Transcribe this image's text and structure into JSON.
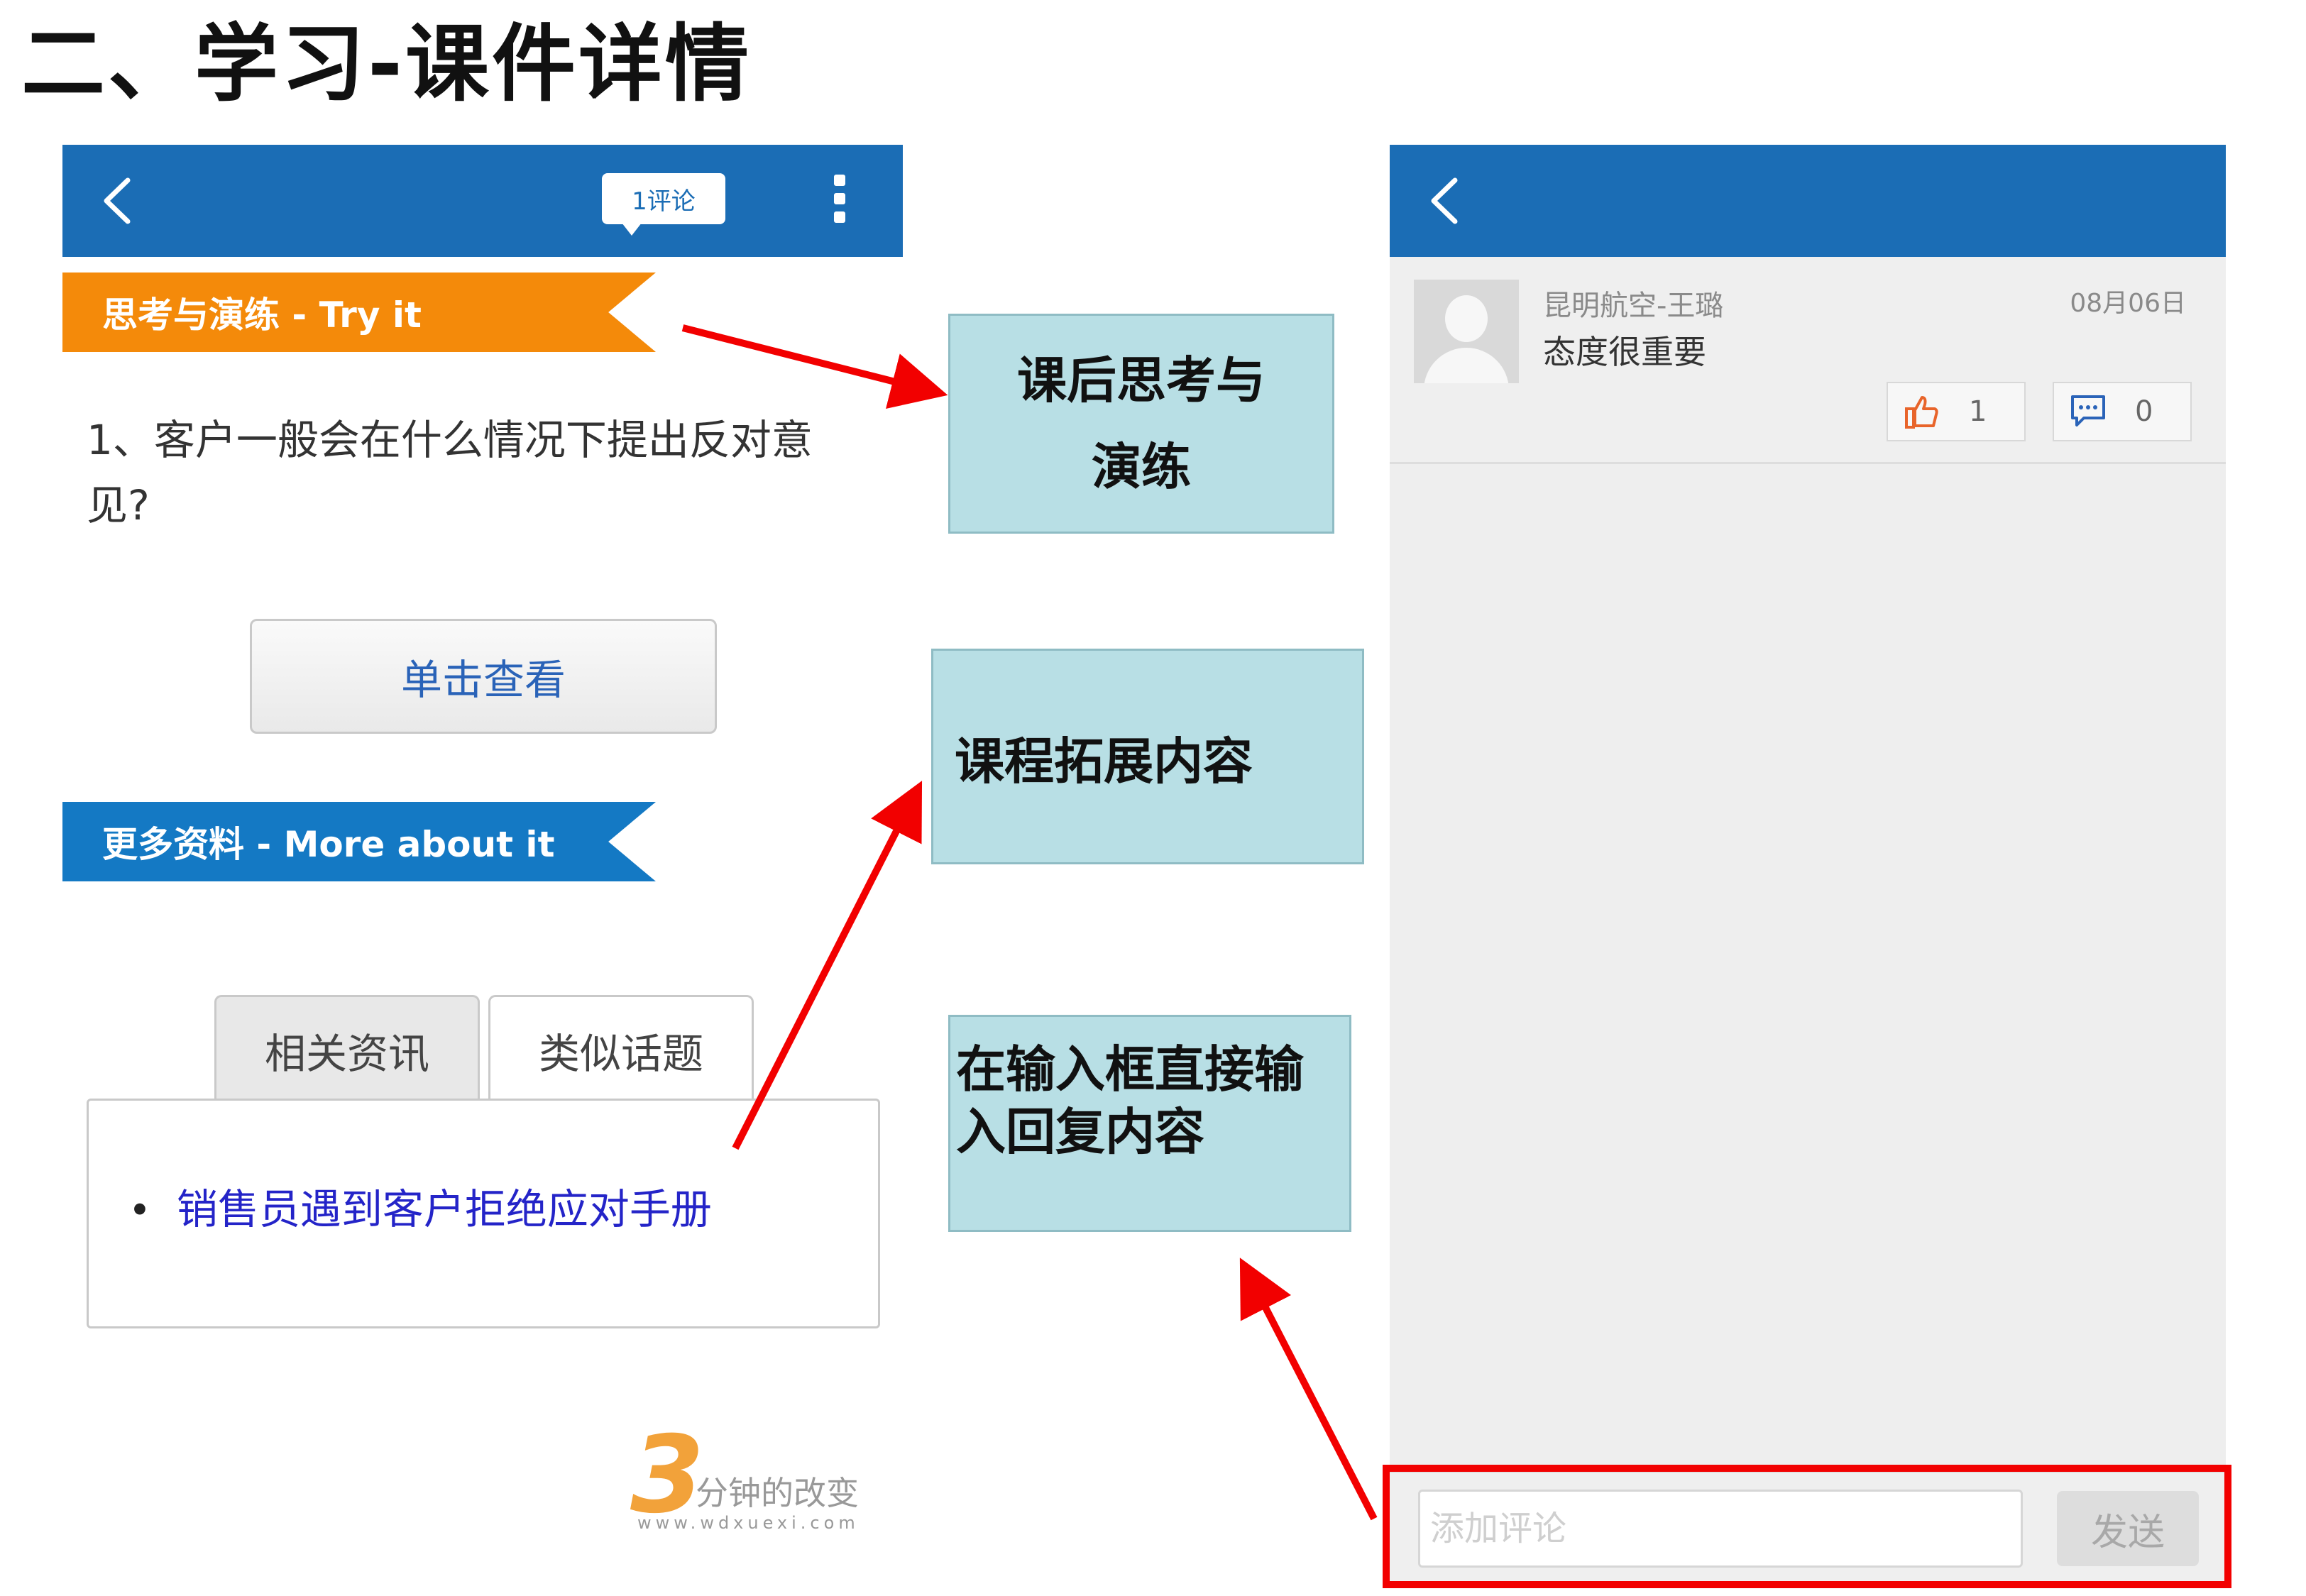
{
  "slide": {
    "title": "二、学习-课件详情"
  },
  "left_phone": {
    "comment_pill": "1评论",
    "banner_try": "思考与演练 - Try it",
    "question_line1": "1、客户一般会在什么情况下提出反对意",
    "question_line2": "见?",
    "view_button": "单击查看",
    "banner_more": "更多资料 - More about it",
    "tabs": [
      {
        "label": "相关资讯"
      },
      {
        "label": "类似话题"
      }
    ],
    "links": [
      {
        "label": "销售员遇到客户拒绝应对手册"
      }
    ],
    "watermark": {
      "digit": "3",
      "name": "分钟的改变",
      "url": "www.wdxuexi.com"
    }
  },
  "notes": {
    "note1_line1": "课后思考与",
    "note1_line2": "演练",
    "note2": "课程拓展内容",
    "note3_line1": "在输入框直接输",
    "note3_line2": "入回复内容"
  },
  "right_phone": {
    "comment": {
      "user": "昆明航空-王璐",
      "date": "08月06日",
      "text": "态度很重要",
      "likes": "1",
      "replies": "0"
    },
    "input_placeholder": "添加评论",
    "send_button": "发送"
  },
  "colors": {
    "header_blue": "#1b6db5",
    "banner_orange": "#f48a0a",
    "banner_blue": "#1479c4",
    "note_bg": "#b8dfe5",
    "arrow_red": "#f20000"
  },
  "icons": [
    "back-arrow-icon",
    "more-vertical-icon",
    "thumbs-up-icon",
    "comment-bubble-icon",
    "user-avatar-icon"
  ]
}
